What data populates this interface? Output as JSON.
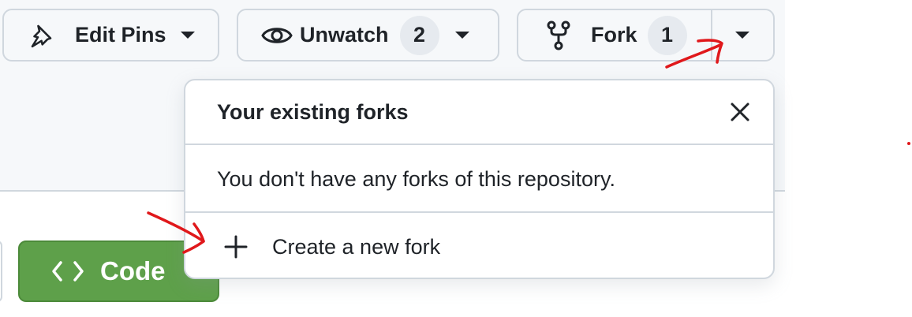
{
  "toolbar": {
    "edit_pins": {
      "label": "Edit Pins",
      "icon": "pin-icon"
    },
    "unwatch": {
      "label": "Unwatch",
      "count": "2",
      "icon": "eye-icon"
    },
    "fork": {
      "label": "Fork",
      "count": "1",
      "icon": "repo-forked-icon"
    }
  },
  "fork_menu": {
    "title": "Your existing forks",
    "empty_message": "You don't have any forks of this repository.",
    "create_label": "Create a new fork"
  },
  "code_button": {
    "label": "Code",
    "icon": "code-icon"
  },
  "colors": {
    "header_bg": "#f6f8fa",
    "border": "#d0d7de",
    "code_green": "#5ea04a",
    "annotation_red": "#e0181b"
  }
}
